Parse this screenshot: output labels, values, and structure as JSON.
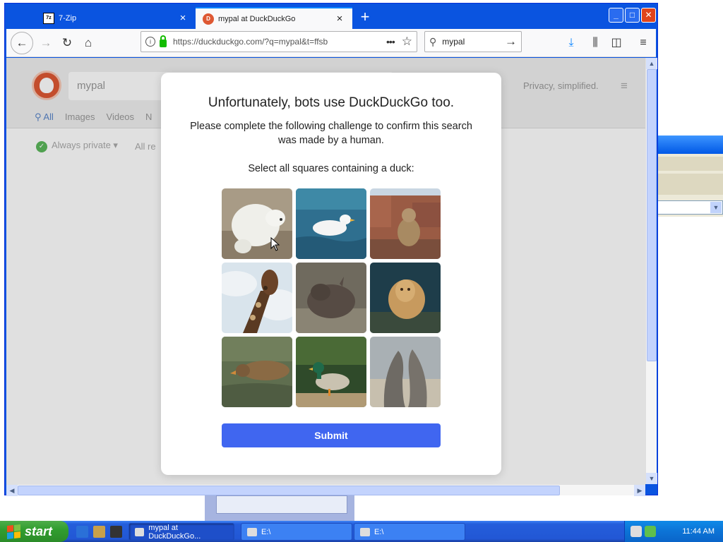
{
  "tabs": [
    {
      "label": "7-Zip",
      "icon": "7zip-icon"
    },
    {
      "label": "mypal at DuckDuckGo",
      "icon": "duckduckgo-icon"
    }
  ],
  "window_buttons": {
    "minimize": "_",
    "maximize": "□",
    "close": "✕"
  },
  "nav": {
    "url": "https://duckduckgo.com/?q=mypal&t=ffsb",
    "search_value": "mypal"
  },
  "ddg": {
    "search_value": "mypal",
    "tagline": "Privacy, simplified.",
    "tabs": [
      "All",
      "Images",
      "Videos",
      "N"
    ],
    "filters": [
      "Always private ▾",
      "All re"
    ]
  },
  "captcha": {
    "title": "Unfortunately, bots use DuckDuckGo too.",
    "description": "Please complete the following challenge to confirm this search was made by a human.",
    "instruction": "Select all squares containing a duck:",
    "images": [
      {
        "subject": "polar-bear"
      },
      {
        "subject": "white-duck"
      },
      {
        "subject": "monkey"
      },
      {
        "subject": "giraffe"
      },
      {
        "subject": "rhino-calf"
      },
      {
        "subject": "lioness"
      },
      {
        "subject": "brown-duck"
      },
      {
        "subject": "mallard-duck"
      },
      {
        "subject": "sea-lions"
      }
    ],
    "submit_label": "Submit"
  },
  "taskbar": {
    "start_label": "start",
    "tasks": [
      {
        "label": "mypal at DuckDuckGo..."
      },
      {
        "label": "E:\\"
      },
      {
        "label": "E:\\"
      }
    ],
    "clock": "11:44 AM"
  }
}
